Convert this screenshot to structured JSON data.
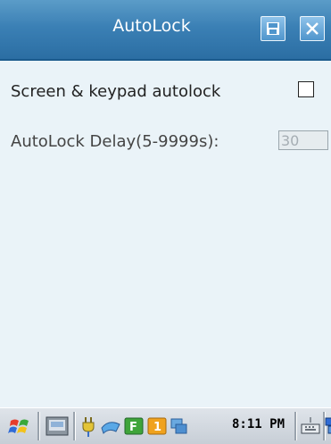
{
  "window": {
    "title": "AutoLock"
  },
  "settings": {
    "autolock_label": "Screen & keypad autolock",
    "autolock_checked": false,
    "delay_label": "AutoLock Delay(5-9999s):",
    "delay_value": "30"
  },
  "taskbar": {
    "clock": "8:11 PM",
    "icons": [
      "windows-start-icon",
      "keyboard-panel-icon",
      "power-plug-icon",
      "network-icon",
      "f-icon",
      "one-icon",
      "sync-icon",
      "input-keyboard-icon",
      "switch-window-icon"
    ]
  },
  "colors": {
    "titlebar": "#3b80b5",
    "background": "#eaf3f8"
  }
}
